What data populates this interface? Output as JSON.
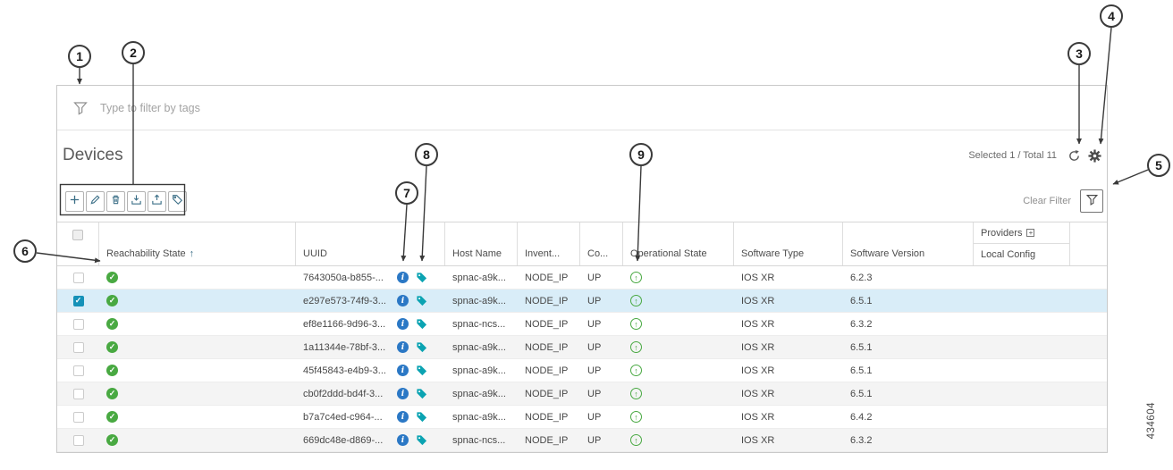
{
  "figure_id": "434604",
  "callouts": [
    "1",
    "2",
    "3",
    "4",
    "5",
    "6",
    "7",
    "8",
    "9"
  ],
  "colors": {
    "success_green": "#49a942",
    "info_blue": "#2b78c5",
    "tag_teal": "#0ba3b2",
    "selected_row_blue": "#d9edf8",
    "toolbar_icon_teal": "#3a6e86",
    "checkbox_teal": "#1591b8"
  },
  "filter_bar": {
    "placeholder": "Type to filter by tags",
    "icon": "funnel-icon"
  },
  "devices_header": {
    "title": "Devices",
    "selection_summary": "Selected 1 / Total 11",
    "icons": [
      "refresh-icon",
      "gear-icon"
    ]
  },
  "toolbar": {
    "button_icons": [
      "add-icon",
      "edit-icon",
      "delete-icon",
      "import-icon",
      "export-icon",
      "tag-icon"
    ],
    "clear_filter_label": "Clear Filter",
    "filter_button_icon": "funnel-icon"
  },
  "table": {
    "columns": {
      "reachability": "Reachability State",
      "uuid": "UUID",
      "host": "Host Name",
      "inventory": "Invent...",
      "config": "Co...",
      "operational": "Operational State",
      "software_type": "Software Type",
      "software_version": "Software Version",
      "providers_group": "Providers",
      "local_config": "Local Config"
    },
    "sort": {
      "column": "Reachability State",
      "direction": "ascending"
    },
    "row_icons": {
      "reachability_ok": "green-check-circle-icon",
      "details": "info-icon",
      "tags": "tag-icon",
      "operational_up": "green-up-arrow-circle-icon"
    },
    "rows": [
      {
        "selected": false,
        "reachability": "ok",
        "uuid": "7643050a-b855-...",
        "host": "spnac-a9k...",
        "inventory": "NODE_IP",
        "config": "UP",
        "operational": "up",
        "software_type": "IOS XR",
        "software_version": "6.2.3"
      },
      {
        "selected": true,
        "reachability": "ok",
        "uuid": "e297e573-74f9-3...",
        "host": "spnac-a9k...",
        "inventory": "NODE_IP",
        "config": "UP",
        "operational": "up",
        "software_type": "IOS XR",
        "software_version": "6.5.1"
      },
      {
        "selected": false,
        "reachability": "ok",
        "uuid": "ef8e1166-9d96-3...",
        "host": "spnac-ncs...",
        "inventory": "NODE_IP",
        "config": "UP",
        "operational": "up",
        "software_type": "IOS XR",
        "software_version": "6.3.2"
      },
      {
        "selected": false,
        "reachability": "ok",
        "uuid": "1a11344e-78bf-3...",
        "host": "spnac-a9k...",
        "inventory": "NODE_IP",
        "config": "UP",
        "operational": "up",
        "software_type": "IOS XR",
        "software_version": "6.5.1"
      },
      {
        "selected": false,
        "reachability": "ok",
        "uuid": "45f45843-e4b9-3...",
        "host": "spnac-a9k...",
        "inventory": "NODE_IP",
        "config": "UP",
        "operational": "up",
        "software_type": "IOS XR",
        "software_version": "6.5.1"
      },
      {
        "selected": false,
        "reachability": "ok",
        "uuid": "cb0f2ddd-bd4f-3...",
        "host": "spnac-a9k...",
        "inventory": "NODE_IP",
        "config": "UP",
        "operational": "up",
        "software_type": "IOS XR",
        "software_version": "6.5.1"
      },
      {
        "selected": false,
        "reachability": "ok",
        "uuid": "b7a7c4ed-c964-...",
        "host": "spnac-a9k...",
        "inventory": "NODE_IP",
        "config": "UP",
        "operational": "up",
        "software_type": "IOS XR",
        "software_version": "6.4.2"
      },
      {
        "selected": false,
        "reachability": "ok",
        "uuid": "669dc48e-d869-...",
        "host": "spnac-ncs...",
        "inventory": "NODE_IP",
        "config": "UP",
        "operational": "up",
        "software_type": "IOS XR",
        "software_version": "6.3.2"
      }
    ]
  }
}
